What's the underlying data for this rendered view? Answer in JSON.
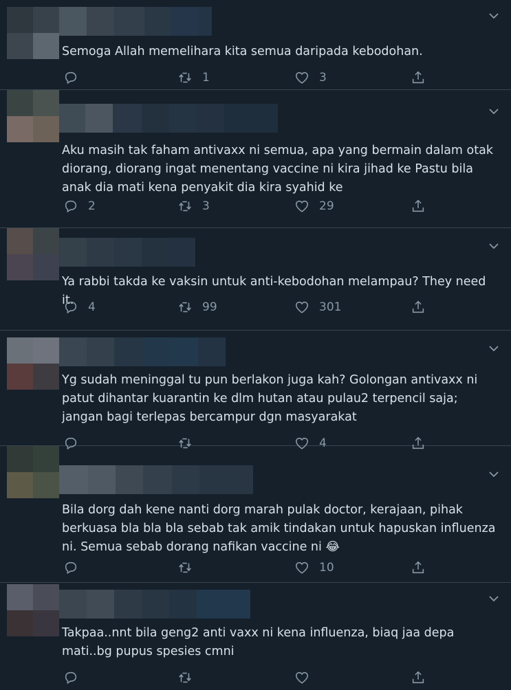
{
  "tweets": [
    {
      "text": "Semoga Allah memelihara kita semua daripada kebodohan.",
      "emoji": "",
      "replies": "",
      "retweets": "1",
      "likes": "3",
      "avatar_colors": [
        "#2f383f",
        "#38424a",
        "#3d464e",
        "#5c6770"
      ],
      "name_colors": [
        "#4a5660",
        "#3a4550",
        "#33404c",
        "#2a3846",
        "#25354a",
        "#233447"
      ]
    },
    {
      "text": "Aku masih tak faham antivaxx ni semua, apa yang bermain dalam otak diorang, diorang ingat menentang vaccine ni kira jihad ke Pastu bila anak dia mati kena penyakit dia kira syahid ke",
      "emoji": "",
      "replies": "2",
      "retweets": "3",
      "likes": "29",
      "avatar_colors": [
        "#3a4442",
        "#4a5350",
        "#7a6a66",
        "#6d6258"
      ],
      "name_colors": [
        "#3f4b55",
        "#4c5660",
        "#2a3746",
        "#23313f",
        "#253443",
        "#233141",
        "#1f2e3c"
      ]
    },
    {
      "text": "Ya rabbi takda ke vaksin untuk anti-kebodohan melampau? They need it.",
      "emoji": "",
      "replies": "4",
      "retweets": "99",
      "likes": "301",
      "avatar_colors": [
        "#574d4a",
        "#3c4448",
        "#4a4550",
        "#3e4250"
      ],
      "name_colors": [
        "#34404a",
        "#2e3a46",
        "#2a3744",
        "#24323f",
        "#233140"
      ]
    },
    {
      "text": "Yg sudah meninggal tu pun berlakon juga kah? Golongan antivaxx ni patut dihantar kuarantin ke dlm hutan atau pulau2 terpencil saja; jangan bagi terlepas bercampur dgn masyarakat",
      "emoji": "",
      "replies": "",
      "retweets": "",
      "likes": "4",
      "avatar_colors": [
        "#6b7178",
        "#6e737d",
        "#5a3c3c",
        "#3e3b41"
      ],
      "name_colors": [
        "#3a4651",
        "#34414c",
        "#273644",
        "#22384a",
        "#22384c",
        "#233344"
      ]
    },
    {
      "text": "Bila dorg dah kene nanti dorg marah pulak doctor, kerajaan, pihak berkuasa bla bla bla sebab tak amik tindakan untuk hapuskan influenza ni. Semua sebab dorang nafikan vaccine ni ",
      "emoji": "😂",
      "replies": "",
      "retweets": "",
      "likes": "10",
      "avatar_colors": [
        "#313a36",
        "#34403a",
        "#5d5a48",
        "#4a5345"
      ],
      "name_colors": [
        "#545e68",
        "#4f5963",
        "#3e4954",
        "#34414d",
        "#2c3a47",
        "#283643"
      ]
    },
    {
      "text": "Takpaa..nnt bila geng2 anti vaxx ni kena influenza, biaq jaa depa mati..bg pupus spesies cmni",
      "emoji": "",
      "replies": "",
      "retweets": "",
      "likes": "",
      "avatar_colors": [
        "#5a5e6a",
        "#4a4c58",
        "#3a3234",
        "#3a3640"
      ],
      "name_colors": [
        "#3b4651",
        "#414b55",
        "#2e3b47",
        "#283644",
        "#243342",
        "#21384d"
      ]
    }
  ]
}
